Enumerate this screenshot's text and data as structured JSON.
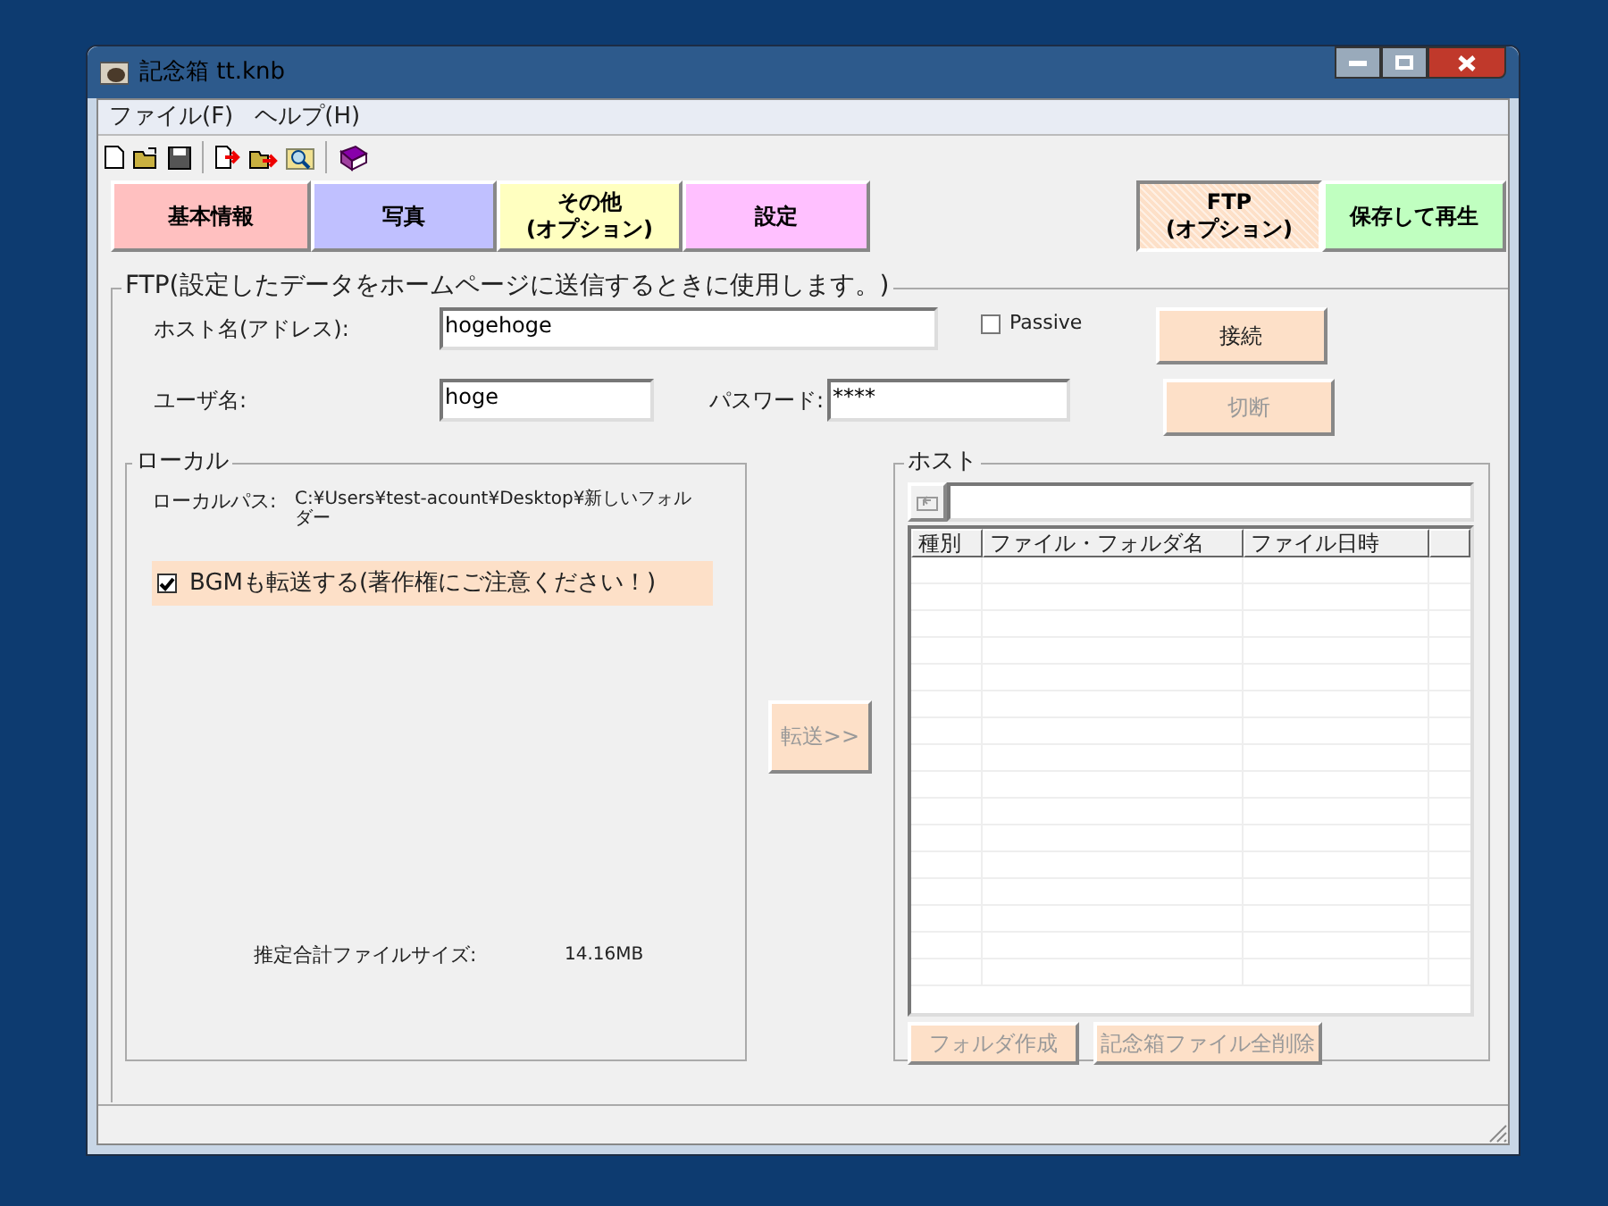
{
  "window": {
    "title": "記念箱 tt.knb"
  },
  "menu": [
    "ファイル(F)",
    "ヘルプ(H)"
  ],
  "tabs": [
    {
      "label": "基本情報",
      "color": "#ffc0c0",
      "selected": false
    },
    {
      "label": "写真",
      "color": "#c0c0ff",
      "selected": false
    },
    {
      "label": "その他\n(オプション)",
      "color": "#ffffc0",
      "selected": false
    },
    {
      "label": "設定",
      "color": "#ffc0ff",
      "selected": false
    },
    {
      "label": "FTP\n(オプション)",
      "color": "#fde0c8",
      "selected": true
    },
    {
      "label": "保存して再生",
      "color": "#c0ffc0",
      "selected": false
    }
  ],
  "ftp": {
    "legend": "FTP(設定したデータをホームページに送信するときに使用します。)",
    "host_label": "ホスト名(アドレス):",
    "host_value": "hogehoge",
    "passive": {
      "label": "Passive",
      "checked": false
    },
    "user_label": "ユーザ名:",
    "user_value": "hoge",
    "password_label": "パスワード:",
    "password_value": "****",
    "connect": {
      "label": "接続",
      "disabled": false
    },
    "disconnect": {
      "label": "切断",
      "disabled": true
    }
  },
  "local": {
    "legend": "ローカル",
    "path_label": "ローカルパス:",
    "path_value": "C:¥Users¥test-acount¥Desktop¥新しいフォルダー",
    "bgm": {
      "label": "BGMも転送する(著作権にご注意ください！)",
      "checked": true
    },
    "size_label": "推定合計ファイルサイズ:",
    "size_value": "14.16MB"
  },
  "transfer": {
    "label": "転送>>",
    "disabled": true
  },
  "host": {
    "legend": "ホスト",
    "columns": [
      "種別",
      "ファイル・フォルダ名",
      "ファイル日時"
    ],
    "buttons": [
      {
        "label": "フォルダ作成",
        "disabled": true
      },
      {
        "label": "記念箱ファイル全削除",
        "disabled": true
      }
    ]
  }
}
